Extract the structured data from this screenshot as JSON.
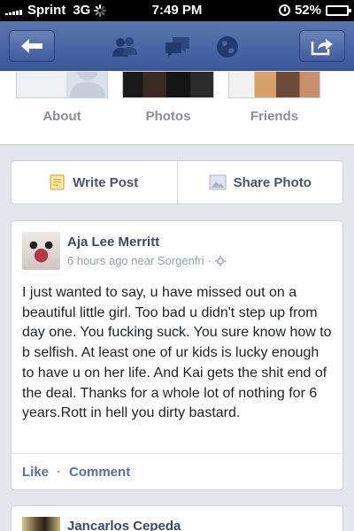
{
  "status_bar": {
    "carrier": "Sprint",
    "network": "3G",
    "time": "7:49 PM",
    "battery": "52%",
    "battery_level": 0.52
  },
  "nav": {
    "icons": [
      "back-arrow-icon",
      "friend-requests-icon",
      "messages-icon",
      "notifications-globe-icon",
      "share-icon"
    ]
  },
  "profile": {
    "tabs": [
      {
        "label": "About"
      },
      {
        "label": "Photos"
      },
      {
        "label": "Friends"
      }
    ]
  },
  "actions": {
    "write_post": "Write Post",
    "share_photo": "Share Photo"
  },
  "post": {
    "author": "Aja Lee Merritt",
    "time": "6 hours ago near Sorgenfri",
    "separator": "·",
    "text": "I just wanted to say, u have missed out on a beautiful little girl. Too bad u didn't step up from day one. You fucking suck. You sure know how to b selfish. At least one of ur kids is lucky enough to have u on her life. And Kai gets the shit end of the deal. Thanks for a whole lot of nothing for 6 years.Rott in hell you dirty bastard.",
    "like_label": "Like",
    "action_separator": "·",
    "comment_label": "Comment"
  },
  "next_post": {
    "author": "Jancarlos Cepeda"
  },
  "colors": {
    "nav": "#3b5998",
    "link": "#5b6f9e",
    "background": "#e3e6ec"
  }
}
